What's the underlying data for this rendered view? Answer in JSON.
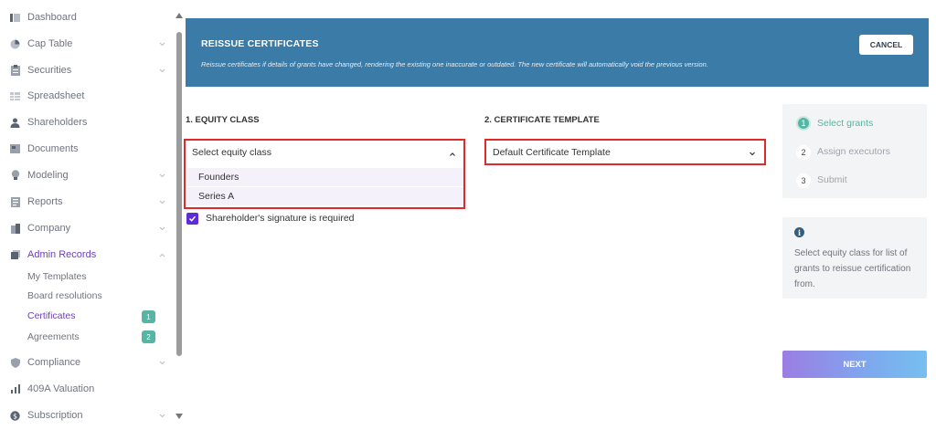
{
  "sidebar": {
    "items": [
      {
        "label": "Dashboard",
        "icon": "dashboard-icon"
      },
      {
        "label": "Cap Table",
        "icon": "pie-chart-icon"
      },
      {
        "label": "Securities",
        "icon": "clipboard-icon"
      },
      {
        "label": "Spreadsheet",
        "icon": "grid-icon"
      },
      {
        "label": "Shareholders",
        "icon": "person-icon"
      },
      {
        "label": "Documents",
        "icon": "document-icon"
      },
      {
        "label": "Modeling",
        "icon": "bulb-icon"
      },
      {
        "label": "Reports",
        "icon": "report-icon"
      },
      {
        "label": "Company",
        "icon": "building-icon"
      },
      {
        "label": "Admin Records",
        "icon": "records-icon"
      },
      {
        "label": "Compliance",
        "icon": "shield-icon"
      },
      {
        "label": "409A Valuation",
        "icon": "chart-icon"
      },
      {
        "label": "Subscription",
        "icon": "dollar-icon"
      }
    ],
    "admin_sub": [
      {
        "label": "My Templates"
      },
      {
        "label": "Board resolutions"
      },
      {
        "label": "Certificates",
        "badge": "1"
      },
      {
        "label": "Agreements",
        "badge": "2"
      }
    ]
  },
  "banner": {
    "title": "REISSUE CERTIFICATES",
    "description": "Reissue certificates if details of grants have changed, rendering the existing one inaccurate or outdated. The new certificate will automatically void the previous version.",
    "cancel_label": "CANCEL"
  },
  "equity": {
    "label": "1. EQUITY CLASS",
    "select_value": "Select equity class",
    "options": [
      "Founders",
      "Series A"
    ]
  },
  "template": {
    "label": "2. CERTIFICATE TEMPLATE",
    "select_value": "Default Certificate Template"
  },
  "checkbox": {
    "label": "Shareholder's signature is required",
    "checked": true
  },
  "steps": [
    {
      "num": "1",
      "label": "Select grants"
    },
    {
      "num": "2",
      "label": "Assign executors"
    },
    {
      "num": "3",
      "label": "Submit"
    }
  ],
  "info": {
    "text": "Select equity class for list of grants to reissue certification from."
  },
  "next_label": "NEXT",
  "colors": {
    "banner": "#3b7ba7",
    "accent_purple": "#6b3fb8",
    "teal": "#56b6a3",
    "highlight_border": "#e02a2a"
  }
}
